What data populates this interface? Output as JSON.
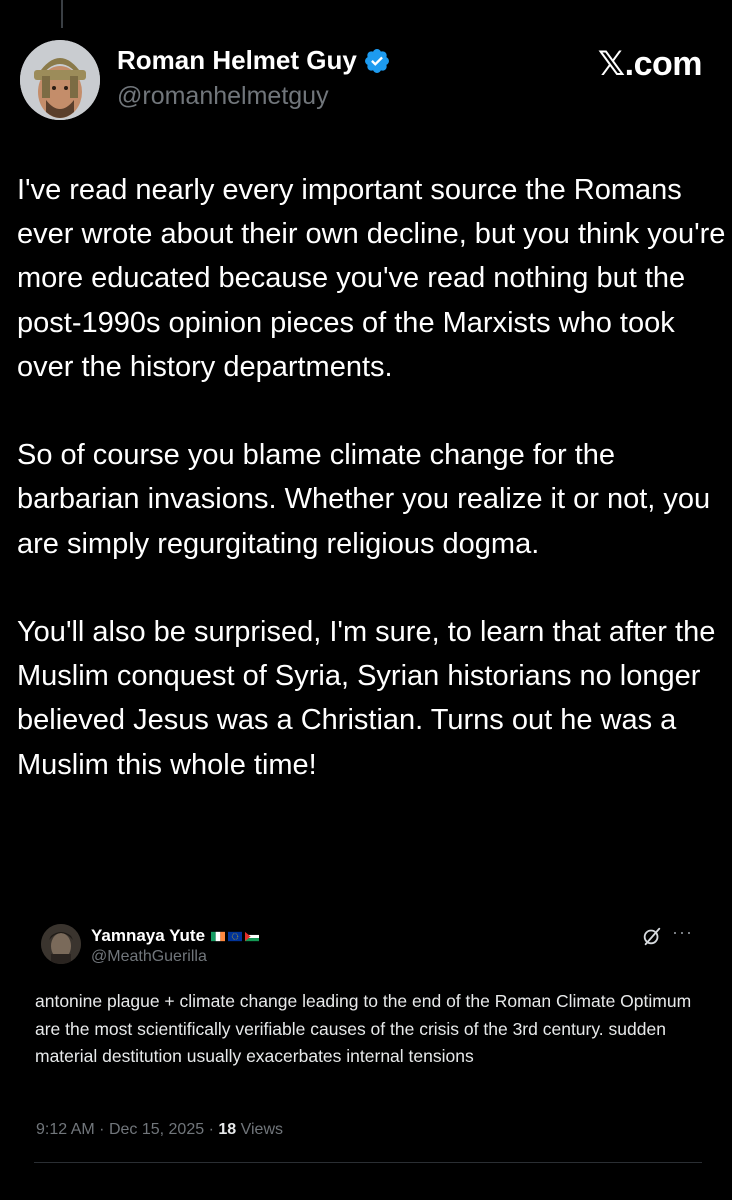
{
  "post": {
    "author_name": "Roman Helmet Guy",
    "author_handle": "@romanhelmetguy",
    "site_logo": "𝕏.com",
    "paragraphs": [
      "I've read nearly every important source the Romans ever wrote about their own decline, but you think you're more educated because you've read nothing but the post-1990s opinion pieces of the Marxists who took over the history departments.",
      "So of course you blame climate change for the barbarian invasions. Whether you realize it or not, you are simply regurgitating religious dogma.",
      "You'll also be surprised, I'm sure, to learn that after the Muslim conquest of Syria, Syrian historians no longer believed Jesus was a Christian. Turns out he was a Muslim this whole time!"
    ]
  },
  "quoted_post": {
    "author_name": "Yamnaya Yute",
    "author_handle": "@MeathGuerilla",
    "text": "antonine plague + climate change leading to the end of the Roman Climate Optimum are the most scientifically verifiable causes of the crisis of the 3rd century. sudden material destitution usually exacerbates internal tensions",
    "time": "9:12 AM",
    "date": "Dec 15, 2025",
    "views_count": "18",
    "views_label": "Views",
    "separator": "·"
  },
  "icons": {
    "verified": "verified-badge-icon",
    "grok": "grok-icon",
    "more": "more-icon",
    "flags": [
      "ireland-flag",
      "eu-flag",
      "palestine-flag"
    ]
  },
  "colors": {
    "background": "#000000",
    "text": "#ffffff",
    "secondary": "#71767b",
    "verified": "#1d9bf0"
  }
}
